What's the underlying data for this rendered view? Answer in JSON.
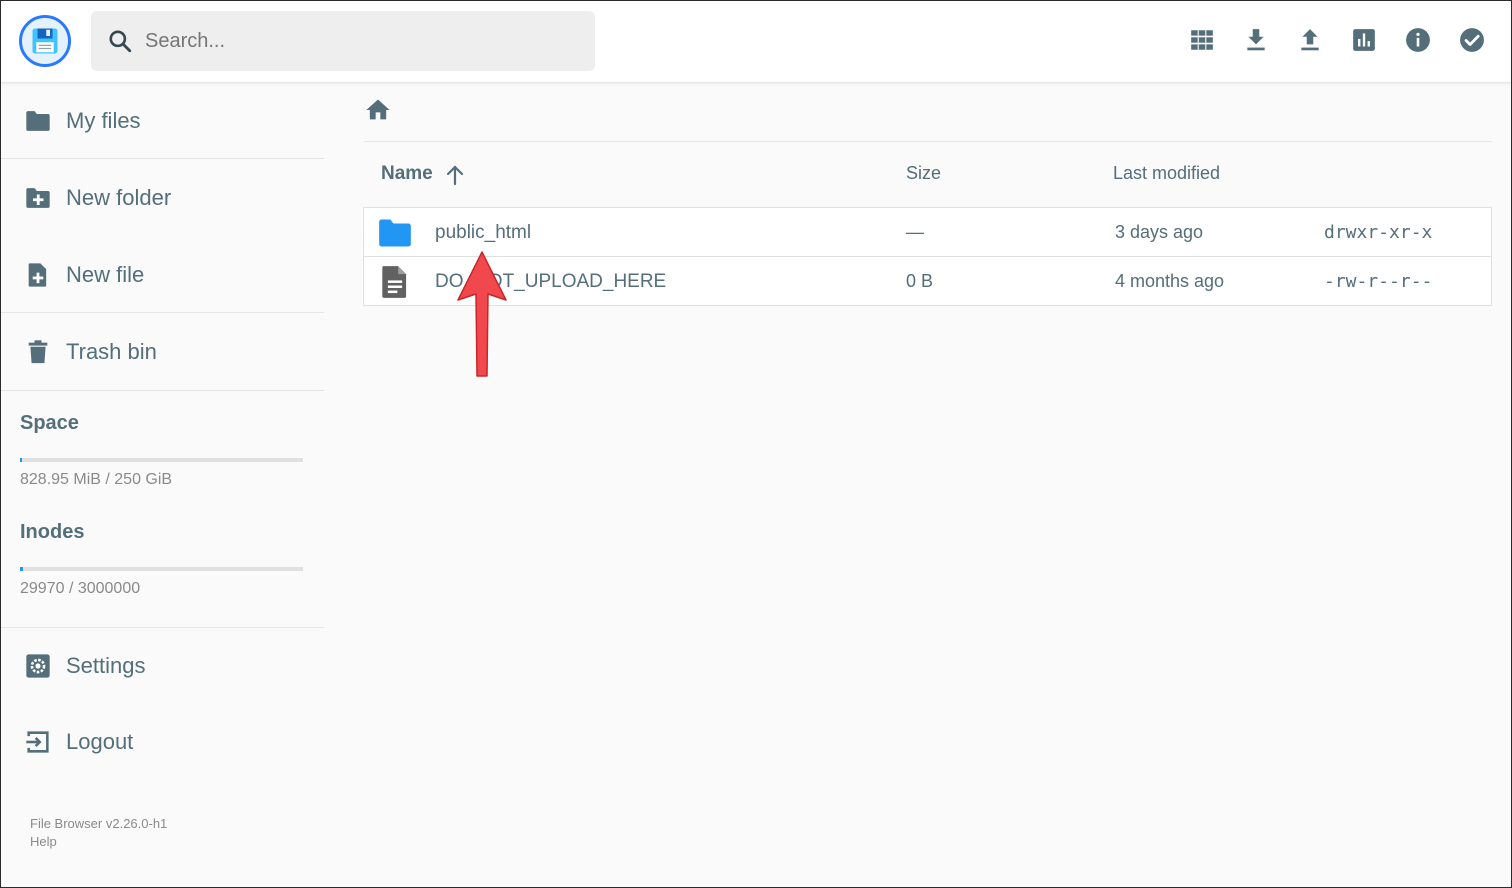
{
  "header": {
    "search_placeholder": "Search...",
    "actions": [
      "grid-view-icon",
      "download-icon",
      "upload-icon",
      "chart-icon",
      "info-icon",
      "check-circle-icon"
    ]
  },
  "sidebar": {
    "items": [
      {
        "label": "My files",
        "icon": "folder-icon"
      },
      {
        "label": "New folder",
        "icon": "folder-plus-icon"
      },
      {
        "label": "New file",
        "icon": "file-plus-icon"
      },
      {
        "label": "Trash bin",
        "icon": "trash-icon"
      }
    ],
    "quota": {
      "space_label": "Space",
      "space_text": "828.95 MiB / 250 GiB",
      "space_fraction": 0.003,
      "inodes_label": "Inodes",
      "inodes_text": "29970 / 3000000",
      "inodes_fraction": 0.01
    },
    "bottom_items": [
      {
        "label": "Settings",
        "icon": "settings-icon"
      },
      {
        "label": "Logout",
        "icon": "logout-icon"
      }
    ],
    "credits": {
      "version": "File Browser v2.26.0-h1",
      "help": "Help"
    }
  },
  "listing": {
    "columns": {
      "name": "Name",
      "size": "Size",
      "modified": "Last modified"
    },
    "sort": "name-ascending",
    "rows": [
      {
        "type": "folder",
        "name": "public_html",
        "size": "—",
        "modified": "3 days ago",
        "perm": "drwxr-xr-x"
      },
      {
        "type": "file",
        "name": "DO_NOT_UPLOAD_HERE",
        "size": "0 B",
        "modified": "4 months ago",
        "perm": "-rw-r--r--"
      }
    ]
  },
  "colors": {
    "accent": "#2196f3",
    "annotation_arrow": "#f0484d",
    "text": "#546e7a"
  }
}
